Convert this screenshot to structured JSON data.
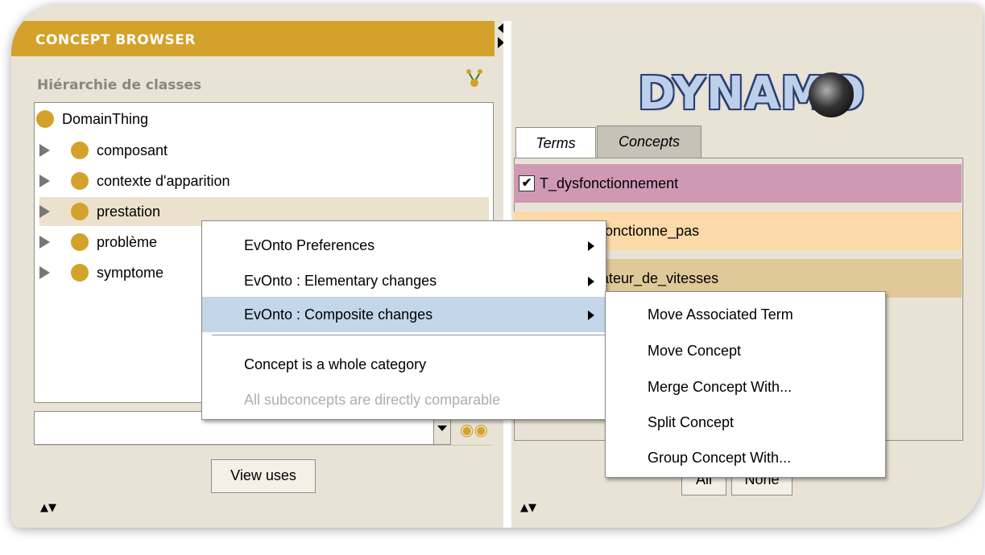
{
  "left_panel": {
    "title": "CONCEPT BROWSER",
    "hierarchy_label": "Hiérarchie de classes",
    "root": "DomainThing",
    "nodes": [
      {
        "label": "composant"
      },
      {
        "label": "contexte d'apparition"
      },
      {
        "label": "prestation",
        "selected": true
      },
      {
        "label": "problème"
      },
      {
        "label": "symptome"
      }
    ],
    "view_uses_label": "View uses"
  },
  "right_panel": {
    "logo_text": "DYNAMO",
    "tabs": [
      {
        "label": "Terms",
        "active": true
      },
      {
        "label": "Concepts"
      }
    ],
    "terms": [
      {
        "label": "T_dysfonctionnement",
        "checked": true,
        "color": "#cf98b4"
      },
      {
        "label": "T_ne_fonctionne_pas",
        "visible_text": "fonctionne_pas",
        "color": "#fcd9a8"
      },
      {
        "label": "T_regulateur_de_vitesses",
        "visible_text": "ateur_de_vitesses",
        "color": "#dfc998"
      }
    ],
    "all_label": "All",
    "none_label": "None"
  },
  "context_menu": {
    "items": [
      {
        "label": "EvOnto Preferences",
        "submenu": true
      },
      {
        "label": "EvOnto : Elementary changes",
        "submenu": true
      },
      {
        "label": "EvOnto : Composite changes",
        "submenu": true,
        "highlighted": true
      },
      {
        "label": "Concept is a whole category"
      },
      {
        "label": "All subconcepts are directly comparable",
        "disabled": true
      }
    ]
  },
  "submenu": {
    "items": [
      {
        "label": "Move Associated Term"
      },
      {
        "label": "Move Concept"
      },
      {
        "label": "Merge Concept With..."
      },
      {
        "label": "Split Concept"
      },
      {
        "label": "Group Concept With..."
      }
    ]
  },
  "colors": {
    "accent": "#d4a12a",
    "menu_highlight": "#c3d6ea",
    "panel_bg": "#e9e3d6"
  }
}
